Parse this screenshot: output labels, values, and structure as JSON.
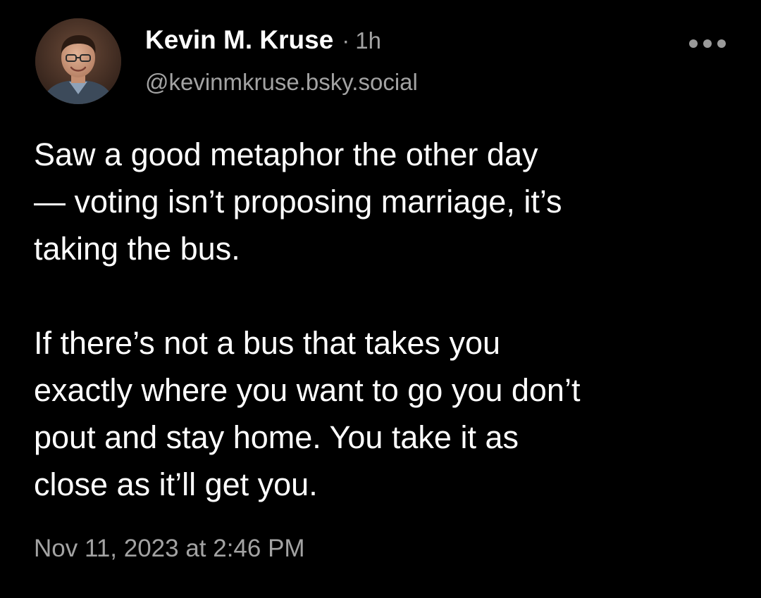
{
  "author": {
    "display_name": "Kevin M. Kruse",
    "separator": "·",
    "time_ago": "1h",
    "handle": "@kevinmkruse.bsky.social",
    "avatar_icon": "profile-photo"
  },
  "post": {
    "paragraphs": [
      {
        "lines": [
          "Saw a good metaphor the other day",
          "— voting isn’t proposing marriage, it’s",
          "taking the bus."
        ]
      },
      {
        "lines": [
          "If there’s not a bus that takes you",
          "exactly where you want to go you don’t",
          "pout and stay home. You take it as",
          "close as it’ll get you."
        ]
      }
    ],
    "timestamp": "Nov 11, 2023 at 2:46 PM"
  },
  "menu": {
    "icon": "more-options-icon"
  },
  "colors": {
    "background": "#000000",
    "primary_text": "#ffffff",
    "secondary_text": "#a3a3a3"
  }
}
